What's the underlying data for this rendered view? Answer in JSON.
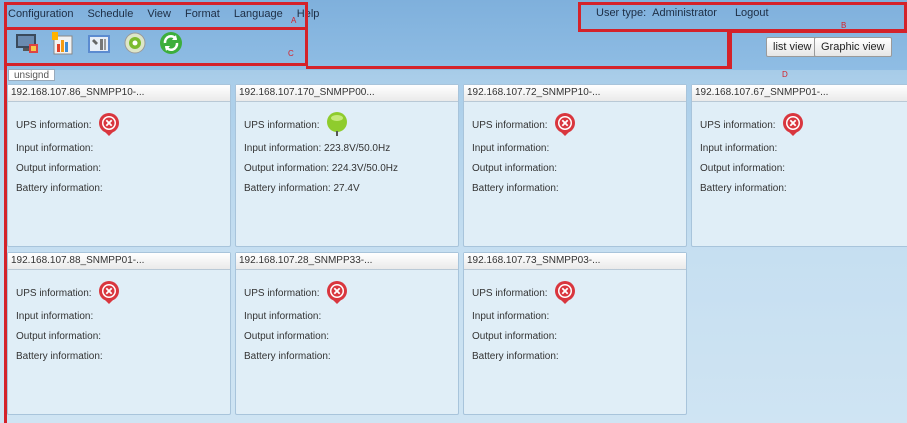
{
  "menu": [
    "Configuration",
    "Schedule",
    "View",
    "Format",
    "Language",
    "Help"
  ],
  "markers": {
    "a": "A",
    "b": "B",
    "c": "C",
    "d": "D"
  },
  "user": {
    "type_label": "User type:",
    "type_value": "Administrator",
    "logout": "Logout"
  },
  "toolbar_icons": [
    "monitor-icon",
    "chart-icon",
    "tools-icon",
    "settings-disc-icon",
    "refresh-icon"
  ],
  "view_buttons": {
    "list": "list view",
    "graphic": "Graphic view"
  },
  "group_label": "unsignd",
  "devices": [
    {
      "name": "192.168.107.86_SNMPP10-...",
      "status": "error",
      "ups": "UPS information:",
      "input": "Input information:",
      "output": "Output information:",
      "battery": "Battery information:"
    },
    {
      "name": "192.168.107.170_SNMPP00...",
      "status": "ok",
      "ups": "UPS information:",
      "input": "Input information: 223.8V/50.0Hz",
      "output": "Output information: 224.3V/50.0Hz",
      "battery": "Battery information: 27.4V"
    },
    {
      "name": "192.168.107.72_SNMPP10-...",
      "status": "error",
      "ups": "UPS information:",
      "input": "Input information:",
      "output": "Output information:",
      "battery": "Battery information:"
    },
    {
      "name": "192.168.107.67_SNMPP01-...",
      "status": "error",
      "ups": "UPS information:",
      "input": "Input information:",
      "output": "Output information:",
      "battery": "Battery information:"
    },
    {
      "name": "192.168.107.88_SNMPP01-...",
      "status": "error",
      "ups": "UPS information:",
      "input": "Input information:",
      "output": "Output information:",
      "battery": "Battery information:"
    },
    {
      "name": "192.168.107.28_SNMPP33-...",
      "status": "error",
      "ups": "UPS information:",
      "input": "Input information:",
      "output": "Output information:",
      "battery": "Battery information:"
    },
    {
      "name": "192.168.107.73_SNMPP03-...",
      "status": "error",
      "ups": "UPS information:",
      "input": "Input information:",
      "output": "Output information:",
      "battery": "Battery information:"
    }
  ],
  "colors": {
    "annotation_red": "#d4222a",
    "error_red": "#d9363e",
    "ok_green": "#8fcc2d"
  }
}
